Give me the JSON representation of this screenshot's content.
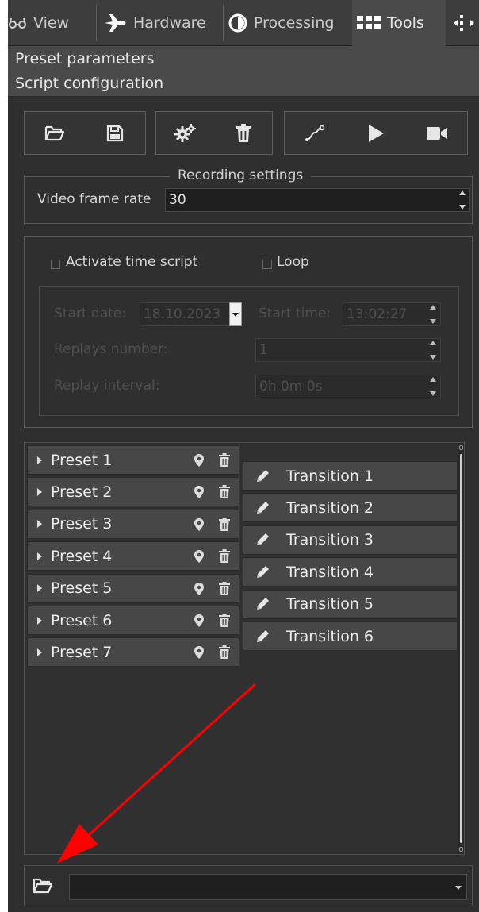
{
  "tabs": [
    {
      "label": "View",
      "icon": "glasses-icon"
    },
    {
      "label": "Hardware",
      "icon": "airplane-icon"
    },
    {
      "label": "Processing",
      "icon": "contrast-icon"
    },
    {
      "label": "Tools",
      "icon": "grid-icon",
      "active": true
    }
  ],
  "sections": {
    "preset_parameters": "Preset parameters",
    "script_configuration": "Script configuration"
  },
  "toolbar": {
    "file_group": [
      "folder-open-icon",
      "save-icon"
    ],
    "edit_group": [
      "gears-icon",
      "trash-icon"
    ],
    "play_group": [
      "path-icon",
      "play-icon",
      "camera-icon"
    ]
  },
  "recording": {
    "title": "Recording settings",
    "frame_rate_label": "Video frame rate",
    "frame_rate_value": "30"
  },
  "time_script": {
    "activate_label": "Activate time script",
    "activate_checked": false,
    "loop_label": "Loop",
    "loop_checked": false,
    "start_date_label": "Start date:",
    "start_date_value": "18.10.2023",
    "start_time_label": "Start time:",
    "start_time_value": "13:02:27",
    "replays_label": "Replays number:",
    "replays_value": "1",
    "interval_label": "Replay interval:",
    "interval_value": "0h 0m 0s"
  },
  "presets": [
    {
      "label": "Preset 1"
    },
    {
      "label": "Preset 2"
    },
    {
      "label": "Preset 3"
    },
    {
      "label": "Preset 4"
    },
    {
      "label": "Preset 5"
    },
    {
      "label": "Preset 6"
    },
    {
      "label": "Preset 7"
    }
  ],
  "transitions": [
    {
      "label": "Transition 1"
    },
    {
      "label": "Transition 2"
    },
    {
      "label": "Transition 3"
    },
    {
      "label": "Transition 4"
    },
    {
      "label": "Transition 5"
    },
    {
      "label": "Transition 6"
    }
  ],
  "bottom": {
    "icon": "folder-open-icon",
    "combo_value": ""
  },
  "colors": {
    "panel_bg": "#2f2f2f",
    "item_bg": "#474747",
    "annotation_arrow": "#ff0000"
  }
}
